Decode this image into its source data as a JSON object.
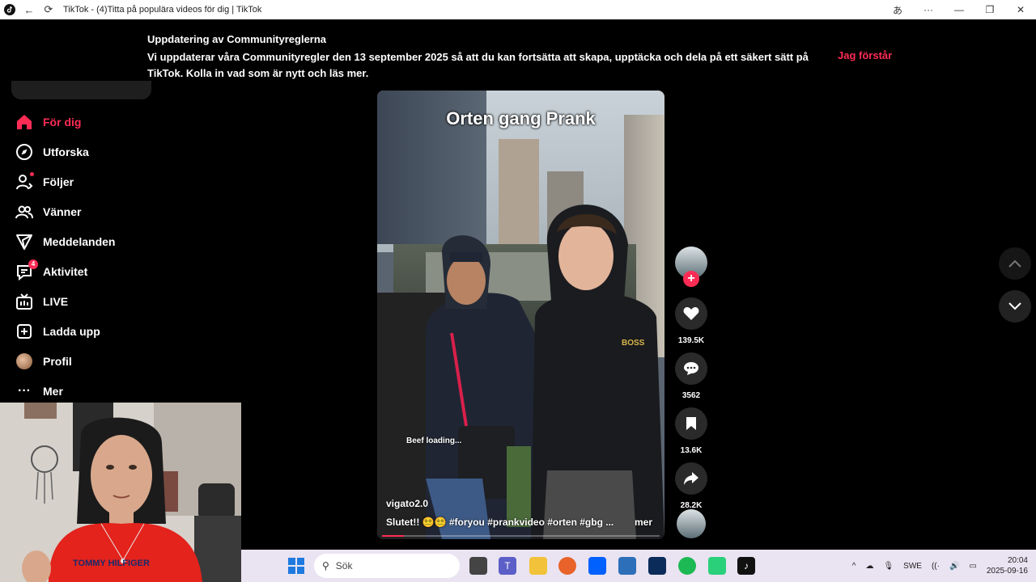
{
  "window": {
    "title": "TikTok - (4)Titta på populära videos för dig | TikTok",
    "controls": [
      "minimize",
      "restore",
      "close"
    ]
  },
  "banner": {
    "title": "Uppdatering av Communityreglerna",
    "text": "Vi uppdaterar våra Communityregler den 13 september 2025 så att du kan fortsätta att skapa, upptäcka och dela på ett säkert sätt på TikTok. Kolla in vad som är nytt och läs mer.",
    "button": "Jag förstår"
  },
  "nav": {
    "items": [
      {
        "label": "För dig",
        "icon": "home-icon",
        "active": true
      },
      {
        "label": "Utforska",
        "icon": "compass-icon"
      },
      {
        "label": "Följer",
        "icon": "user-follow-icon"
      },
      {
        "label": "Vänner",
        "icon": "friends-icon"
      },
      {
        "label": "Meddelanden",
        "icon": "send-icon"
      },
      {
        "label": "Aktivitet",
        "icon": "activity-icon",
        "badge": "4"
      },
      {
        "label": "LIVE",
        "icon": "live-tv-icon"
      },
      {
        "label": "Ladda upp",
        "icon": "upload-plus-icon"
      },
      {
        "label": "Profil",
        "icon": "profile-avatar"
      },
      {
        "label": "Mer",
        "icon": "more-dots-icon"
      }
    ]
  },
  "video": {
    "overlay_title": "Orten gang Prank",
    "loading_text": "Beef loading...",
    "username": "vigato2.0",
    "caption": "Slutet!! 😵‍💫😵‍💫 #foryou  #prankvideo  #orten  #gbg  ...",
    "more": "mer",
    "progress_percent": 8
  },
  "actions": {
    "likes": "139.5K",
    "comments": "3562",
    "saves": "13.6K",
    "shares": "28.2K"
  },
  "taskbar": {
    "search_placeholder": "Sök",
    "language": "SWE",
    "time": "20:04",
    "date": "2025-09-16"
  },
  "colors": {
    "accent": "#fe2c55",
    "background": "#000000",
    "taskbar": "#eae3f2"
  }
}
